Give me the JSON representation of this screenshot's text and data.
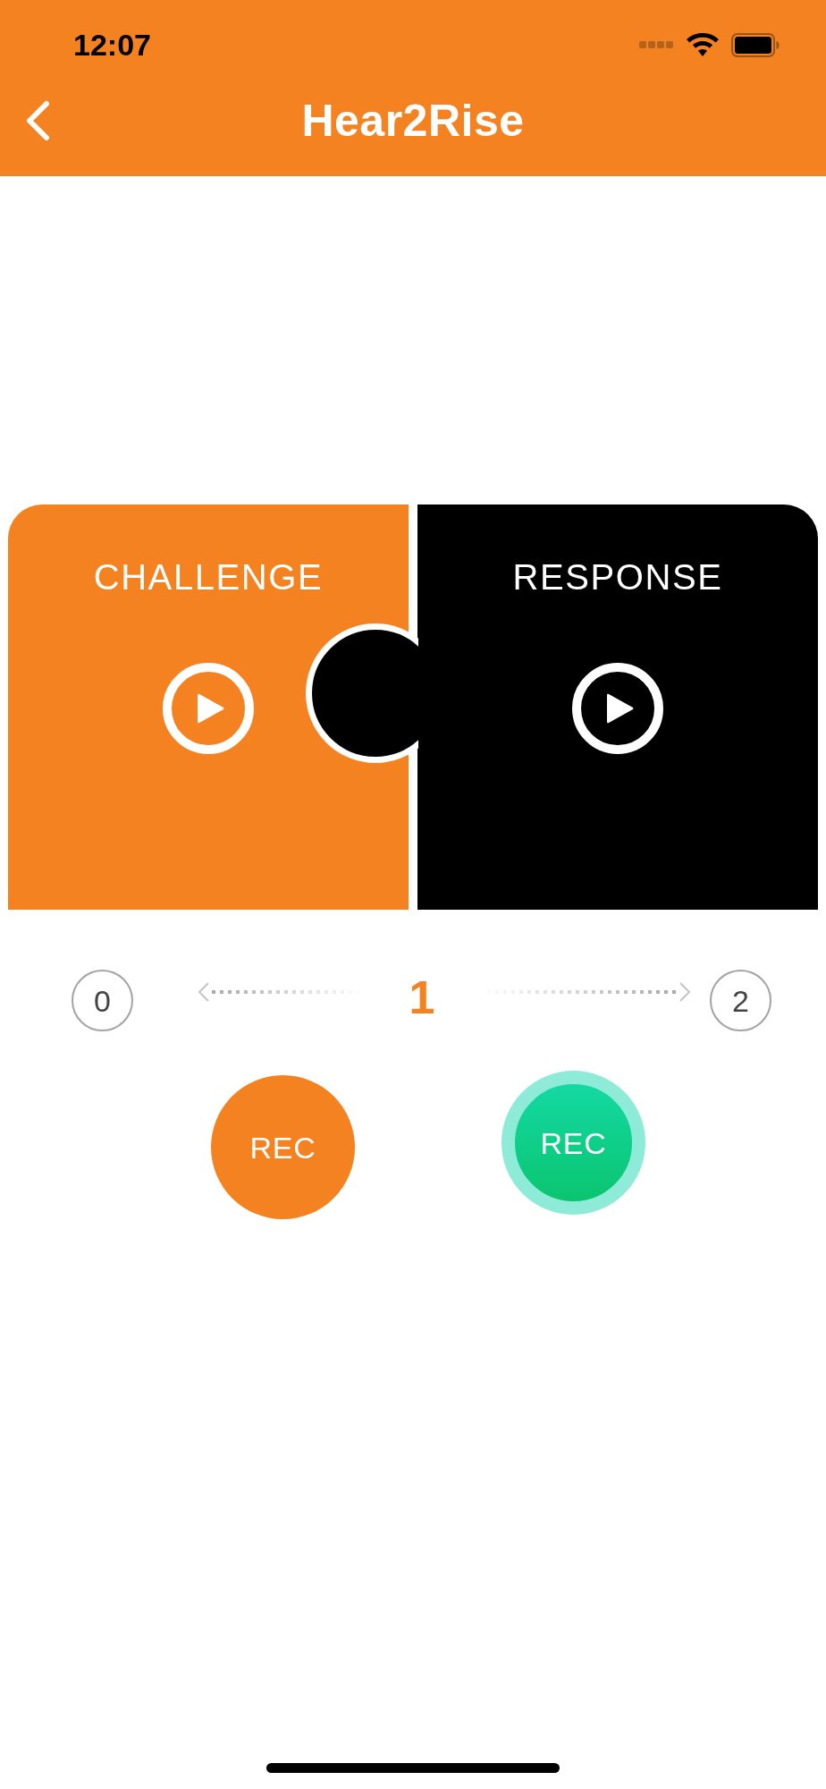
{
  "status_bar": {
    "time": "12:07"
  },
  "nav_bar": {
    "title": "Hear2Rise"
  },
  "puzzle": {
    "panels": [
      {
        "kind": "challenge",
        "label": "CHALLENGE"
      },
      {
        "kind": "response",
        "label": "RESPONSE"
      }
    ]
  },
  "counter": {
    "previous": "0",
    "current": "1",
    "next": "2"
  },
  "record_buttons": [
    {
      "label": "REC",
      "active": false
    },
    {
      "label": "REC",
      "active": true
    }
  ]
}
